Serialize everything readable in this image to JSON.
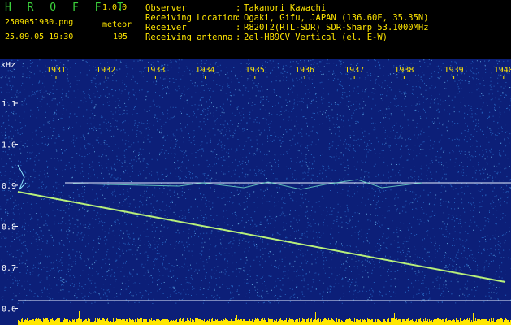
{
  "header": {
    "app_title": "H R O F F T",
    "app_version": "1.0.0",
    "filename": "2509051930.png",
    "mode": "meteor",
    "datetime": "25.09.05 19:30",
    "count": "105",
    "info": [
      {
        "label": "Observer",
        "value": "Takanori Kawachi"
      },
      {
        "label": "Receiving Location",
        "value": "Ogaki, Gifu, JAPAN (136.60E, 35.35N)"
      },
      {
        "label": "Receiver",
        "value": "R820T2(RTL-SDR) SDR-Sharp 53.1000MHz"
      },
      {
        "label": "Receiving antenna",
        "value": "2el-HB9CV Vertical (el. E-W)"
      }
    ],
    "separator": ":"
  },
  "spectrogram": {
    "y_unit": "kHz",
    "x_ticks": [
      "1931",
      "1932",
      "1933",
      "1934",
      "1935",
      "1936",
      "1937",
      "1938",
      "1939",
      "1940"
    ],
    "y_ticks": [
      "1.1",
      "1.0",
      "0.9",
      "0.8",
      "0.7",
      "0.6"
    ],
    "colors": {
      "background": "#0c1f78",
      "noise": "#2e7ad6",
      "trace": "#b8f07a",
      "reference_line": "#e8f0ff",
      "tick_label": "#ffe600",
      "axis_text": "#ffffff",
      "power_bar": "#ffe600"
    }
  }
}
